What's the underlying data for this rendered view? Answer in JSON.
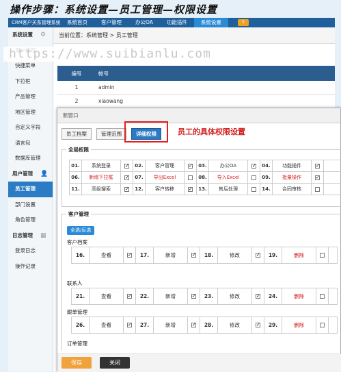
{
  "page_title": "操作步骤：系统设置—员工管理—权限设置",
  "watermark": "https://www.suibianlu.com",
  "topnav": {
    "brand": "CRM客户关系管理系统",
    "tabs": [
      "系统首页",
      "客户管理",
      "办公OA",
      "功能插件",
      "系统设置"
    ],
    "active_tab": "系统设置",
    "mail_count": "5"
  },
  "sidebar": {
    "items": [
      {
        "label": "系统设置",
        "type": "group",
        "icon": "gear-icon"
      },
      {
        "label": "用户管理",
        "type": "item"
      },
      {
        "label": "快捷菜单",
        "type": "item"
      },
      {
        "label": "下拉框",
        "type": "item"
      },
      {
        "label": "产品管理",
        "type": "item"
      },
      {
        "label": "地区管理",
        "type": "item"
      },
      {
        "label": "自定义字段",
        "type": "item"
      },
      {
        "label": "语言包",
        "type": "item"
      },
      {
        "label": "数据库管理",
        "type": "item"
      },
      {
        "label": "用户管理",
        "type": "group",
        "icon": "user-icon"
      },
      {
        "label": "员工管理",
        "type": "active"
      },
      {
        "label": "部门设置",
        "type": "item"
      },
      {
        "label": "角色管理",
        "type": "item"
      },
      {
        "label": "日志管理",
        "type": "group",
        "icon": "calendar-icon"
      },
      {
        "label": "登录日志",
        "type": "item"
      },
      {
        "label": "操作记录",
        "type": "item"
      }
    ]
  },
  "breadcrumb": "当前位置：系统管理 > 员工管理",
  "user_table": {
    "headers": [
      "编号",
      "帐号"
    ],
    "rows": [
      [
        "1",
        "admin"
      ],
      [
        "2",
        "xiaowang"
      ]
    ]
  },
  "modal": {
    "title": "新窗口",
    "tabs": [
      "员工档案",
      "管理范围",
      "详细权限"
    ],
    "active_tab": "详细权限",
    "annotation": "员工的具体权限设置",
    "global_legend": "全局权限",
    "global_rows": [
      [
        {
          "n": "01.",
          "l": "系统登录",
          "c": true,
          "r": false
        },
        {
          "n": "02.",
          "l": "客户管理",
          "c": true,
          "r": false
        },
        {
          "n": "03.",
          "l": "办公OA",
          "c": true,
          "r": false
        },
        {
          "n": "04.",
          "l": "功能插件",
          "c": true,
          "r": false
        }
      ],
      [
        {
          "n": "06.",
          "l": "新增下拉框",
          "c": true,
          "r": true
        },
        {
          "n": "07.",
          "l": "导出Excel",
          "c": false,
          "r": true
        },
        {
          "n": "08.",
          "l": "导入Excel",
          "c": false,
          "r": true
        },
        {
          "n": "09.",
          "l": "批量操作",
          "c": true,
          "r": true
        }
      ],
      [
        {
          "n": "11.",
          "l": "高级搜索",
          "c": true,
          "r": false
        },
        {
          "n": "12.",
          "l": "客户转移",
          "c": true,
          "r": false
        },
        {
          "n": "13.",
          "l": "售后处理",
          "c": false,
          "r": false
        },
        {
          "n": "14.",
          "l": "合同审核",
          "c": false,
          "r": false
        }
      ]
    ],
    "customer_legend": "客户管理",
    "select_all": "全选/反选",
    "sections": [
      {
        "title": "客户档案",
        "cells": [
          {
            "n": "16.",
            "l": "查看",
            "c": true,
            "r": false
          },
          {
            "n": "17.",
            "l": "新增",
            "c": true,
            "r": false
          },
          {
            "n": "18.",
            "l": "修改",
            "c": true,
            "r": false
          },
          {
            "n": "19.",
            "l": "删除",
            "c": false,
            "r": true
          }
        ]
      },
      {
        "title": "联系人",
        "cells": [
          {
            "n": "21.",
            "l": "查看",
            "c": true,
            "r": false
          },
          {
            "n": "22.",
            "l": "新增",
            "c": true,
            "r": false
          },
          {
            "n": "23.",
            "l": "修改",
            "c": true,
            "r": false
          },
          {
            "n": "24.",
            "l": "删除",
            "c": false,
            "r": true
          }
        ]
      },
      {
        "title": "跟单管理",
        "cells": [
          {
            "n": "26.",
            "l": "查看",
            "c": true,
            "r": false
          },
          {
            "n": "27.",
            "l": "新增",
            "c": true,
            "r": false
          },
          {
            "n": "28.",
            "l": "修改",
            "c": true,
            "r": false
          },
          {
            "n": "29.",
            "l": "删除",
            "c": false,
            "r": true
          }
        ]
      },
      {
        "title": "订单管理",
        "cells": []
      }
    ],
    "save_label": "保存",
    "close_label": "关闭"
  },
  "colors": {
    "nav": "#1f5f9c",
    "accent": "#2b7ac3",
    "red": "#d21c1c",
    "save": "#f0a23c"
  }
}
